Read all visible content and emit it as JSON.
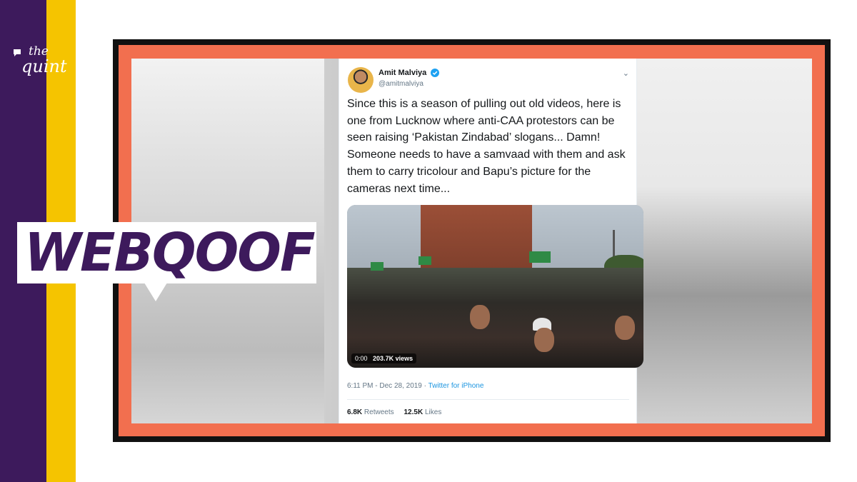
{
  "brand": {
    "the": "the",
    "quint": "quint"
  },
  "colors": {
    "purple": "#3d1a5c",
    "yellow": "#f5c400",
    "frame_orange": "#f26f4f",
    "link_blue": "#1b95e0"
  },
  "tweet": {
    "name": "Amit Malviya",
    "handle": "@amitmalviya",
    "verified_icon": "verified-badge-icon",
    "caret_icon": "chevron-down-icon",
    "text": "Since this is a season of pulling out old videos, here is one from Lucknow where anti-CAA protestors can be seen raising ‘Pakistan Zindabad’ slogans... Damn! Someone needs to have a samvaad with them and ask them to carry tricolour and Bapu’s picture for the cameras next time...",
    "video": {
      "time": "0:00",
      "views": "203.7K views"
    },
    "timestamp": "6:11 PM - Dec 28, 2019",
    "separator": " · ",
    "source": "Twitter for iPhone",
    "retweets_count": "6.8K",
    "retweets_label": "Retweets",
    "likes_count": "12.5K",
    "likes_label": "Likes"
  },
  "badge": {
    "label": "WEBQOOF"
  }
}
